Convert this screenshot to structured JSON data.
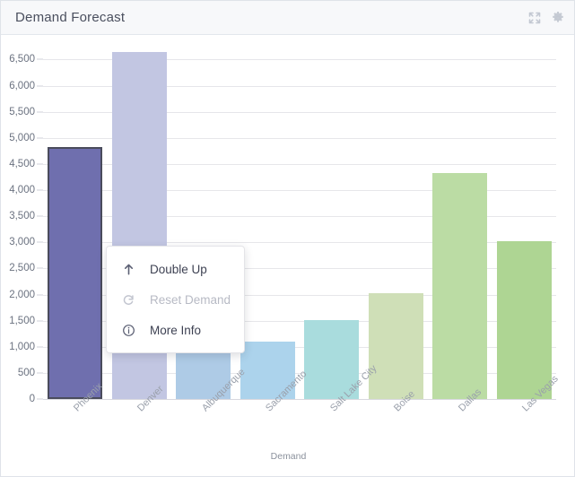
{
  "header": {
    "title": "Demand Forecast",
    "actions": [
      {
        "name": "expand-icon",
        "label": "Expand"
      },
      {
        "name": "gear-icon",
        "label": "Settings"
      }
    ]
  },
  "context_menu": {
    "items": [
      {
        "label": "Double Up",
        "icon": "arrow-up-icon",
        "disabled": false
      },
      {
        "label": "Reset Demand",
        "icon": "reset-icon",
        "disabled": true
      },
      {
        "label": "More Info",
        "icon": "info-circle-icon",
        "disabled": false
      }
    ]
  },
  "chart_data": {
    "type": "bar",
    "title": "Demand Forecast",
    "xlabel": "Demand",
    "ylabel": "",
    "ylim": [
      0,
      6800
    ],
    "grid": true,
    "legend": "none",
    "categories": [
      "Phoenix",
      "Denver",
      "Albuquerque",
      "Sacramento",
      "Salt Lake City",
      "Boise",
      "Dallas",
      "Las Vegas"
    ],
    "values": [
      4830,
      6650,
      1060,
      1100,
      1510,
      2020,
      4320,
      3030
    ],
    "colors": [
      "#6f6fae",
      "#c2c6e2",
      "#aecbe6",
      "#acd3ec",
      "#a9dcdd",
      "#cfdfb7",
      "#bbdca4",
      "#aed593"
    ],
    "selected_index": 0,
    "selected_border_color": "#4a4c5c",
    "ytick_labels": [
      "0",
      "500",
      "1,000",
      "1,500",
      "2,000",
      "2,500",
      "3,000",
      "3,500",
      "4,000",
      "4,500",
      "5,000",
      "5,500",
      "6,000",
      "6,500"
    ],
    "ytick_values": [
      0,
      500,
      1000,
      1500,
      2000,
      2500,
      3000,
      3500,
      4000,
      4500,
      5000,
      5500,
      6000,
      6500
    ]
  }
}
